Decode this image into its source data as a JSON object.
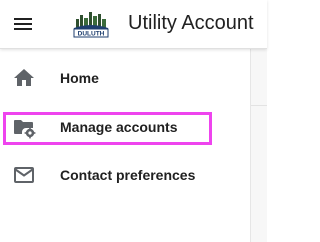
{
  "header": {
    "title": "Utility Account",
    "menu_icon": "hamburger-menu-icon",
    "logo": {
      "text": "DULUTH",
      "icon": "city-skyline-logo"
    }
  },
  "sidebar": {
    "items": [
      {
        "label": "Home",
        "icon": "home-icon"
      },
      {
        "label": "Manage accounts",
        "icon": "folder-settings-icon"
      },
      {
        "label": "Contact preferences",
        "icon": "mail-icon"
      }
    ]
  },
  "colors": {
    "highlight": "#ee44ee",
    "icon": "#5f6368",
    "text": "#212121"
  }
}
